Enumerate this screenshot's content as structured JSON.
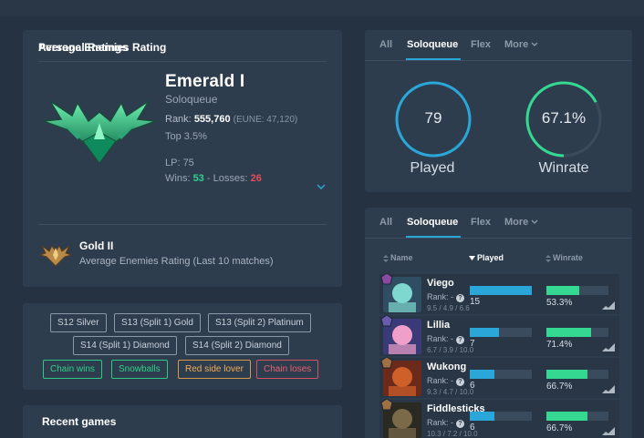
{
  "personal": {
    "title": "Personal Ratings",
    "rank_name": "Emerald I",
    "queue": "Soloqueue",
    "rank_label": "Rank:",
    "rank_value": "555,760",
    "rank_regional": "(EUNE: 47,120)",
    "top": "Top 3.5%",
    "lp": "LP: 75",
    "wins_label": "Wins:",
    "wins": "53",
    "sep": "-",
    "losses_label": "Losses:",
    "losses": "26",
    "avg_title": "Average Enemies Rating",
    "avg_rank": "Gold II",
    "avg_desc": "Average Enemies Rating (Last 10 matches)"
  },
  "tags": [
    {
      "label": "S12 Silver",
      "style": "neutral"
    },
    {
      "label": "S13 (Split 1) Gold",
      "style": "neutral"
    },
    {
      "label": "S13 (Split 2) Platinum",
      "style": "neutral"
    },
    {
      "label": "S14 (Split 1) Diamond",
      "style": "neutral"
    },
    {
      "label": "S14 (Split 2) Diamond",
      "style": "neutral"
    },
    {
      "label": "Chain wins",
      "style": "green"
    },
    {
      "label": "Snowballs",
      "style": "green"
    },
    {
      "label": "Red side lover",
      "style": "orange"
    },
    {
      "label": "Chain loses",
      "style": "red"
    }
  ],
  "recent": {
    "title": "Recent games"
  },
  "tabs": {
    "all": "All",
    "solo": "Soloqueue",
    "flex": "Flex",
    "more": "More",
    "active": "Soloqueue"
  },
  "stats": {
    "played_value": "79",
    "played_label": "Played",
    "winrate_value": "67.1%",
    "winrate_label": "Winrate",
    "winrate_fraction": 0.671
  },
  "table": {
    "col_name": "Name",
    "col_played": "Played",
    "col_winrate": "Winrate",
    "rows": [
      {
        "name": "Viego",
        "rank": "Rank: -",
        "kda": "9.5 / 4.9 / 6.6",
        "played": "15",
        "played_frac": 1.0,
        "winrate": "53.3%",
        "wr_frac": 0.533,
        "icon": "viego-portrait"
      },
      {
        "name": "Lillia",
        "rank": "Rank: -",
        "kda": "6.7 / 3.9 / 10.0",
        "played": "7",
        "played_frac": 0.47,
        "winrate": "71.4%",
        "wr_frac": 0.714,
        "icon": "lillia-portrait"
      },
      {
        "name": "Wukong",
        "rank": "Rank: -",
        "kda": "9.3 / 4.7 / 10.0",
        "played": "6",
        "played_frac": 0.4,
        "winrate": "66.7%",
        "wr_frac": 0.667,
        "icon": "wukong-portrait"
      },
      {
        "name": "Fiddlesticks",
        "rank": "Rank: -",
        "kda": "10.3 / 7.2 / 10.0",
        "played": "6",
        "played_frac": 0.4,
        "winrate": "66.7%",
        "wr_frac": 0.667,
        "icon": "fiddlesticks-portrait"
      }
    ]
  },
  "colors": {
    "played_ring": "#2aa7d8",
    "winrate_ring": "#34d890",
    "wins": "#2fd18b",
    "losses": "#e84d5b"
  }
}
